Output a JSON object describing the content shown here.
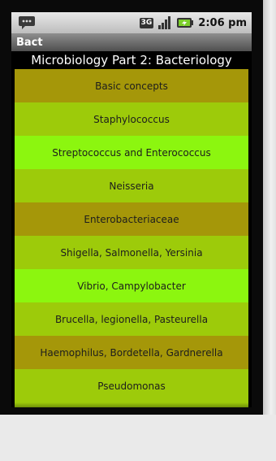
{
  "status_bar": {
    "network": "3G",
    "time": "2:06 pm",
    "icons": [
      "message-icon",
      "network-3g-icon",
      "signal-icon",
      "battery-icon"
    ]
  },
  "app": {
    "title": "Bact",
    "heading": "Microbiology Part 2: Bacteriology"
  },
  "menu": {
    "items": [
      {
        "label": "Basic concepts",
        "tone": "olive"
      },
      {
        "label": "Staphylococcus",
        "tone": "green"
      },
      {
        "label": "Streptococcus and Enterococcus",
        "tone": "lime"
      },
      {
        "label": "Neisseria",
        "tone": "green"
      },
      {
        "label": "Enterobacteriaceae",
        "tone": "olive"
      },
      {
        "label": "Shigella, Salmonella, Yersinia",
        "tone": "green"
      },
      {
        "label": "Vibrio, Campylobacter",
        "tone": "lime"
      },
      {
        "label": "Brucella, legionella, Pasteurella",
        "tone": "green"
      },
      {
        "label": "Haemophilus, Bordetella, Gardnerella",
        "tone": "olive"
      },
      {
        "label": "Pseudomonas",
        "tone": "green"
      }
    ]
  },
  "colors": {
    "olive": "#a59709",
    "green": "#9dcb0a",
    "lime": "#8cf60f"
  }
}
